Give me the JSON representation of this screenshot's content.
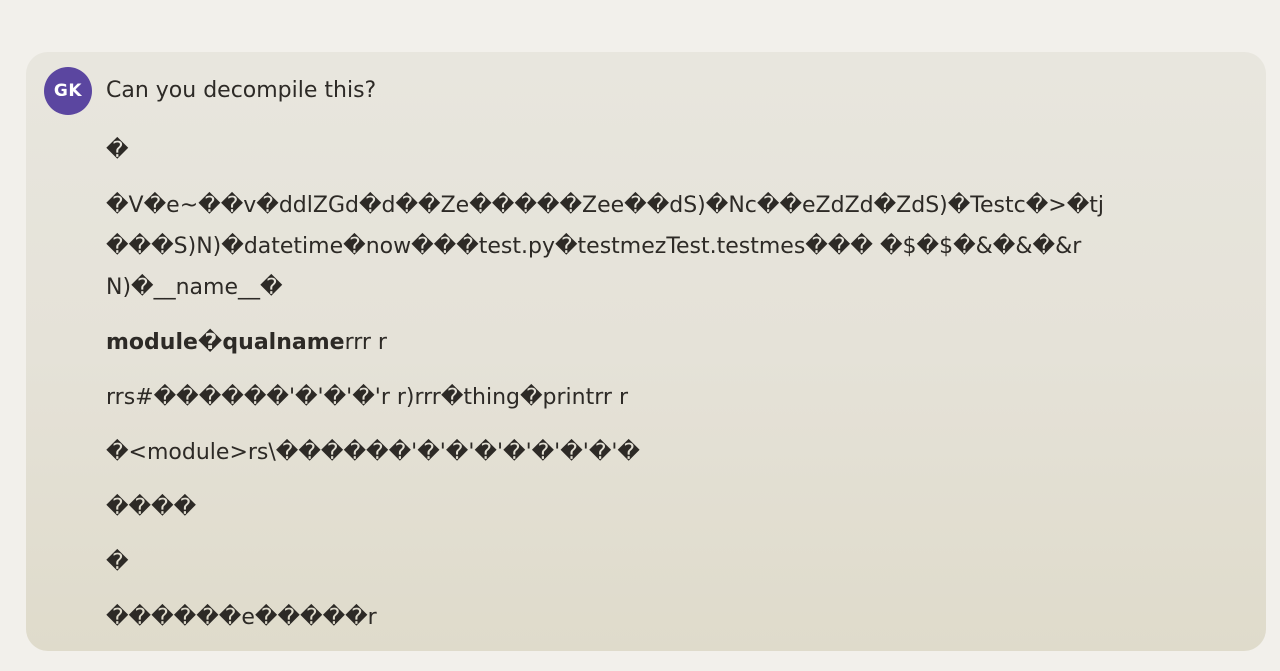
{
  "message": {
    "avatar_initials": "GK",
    "avatar_color": "#5b46a0",
    "prompt": "Can you decompile this?",
    "lines": {
      "l1": "�",
      "l2": "�V�e~��v�ddlZGd�d��Ze�����Zee��dS)�Nc��eZdZd�ZdS)�Testc�>�tj",
      "l3": "���S)N)�datetime�now���test.py�testmezTest.testmes��� �$�$�&�&�&r",
      "l4": "N)�__name__�",
      "l5_bold": "module�qualname",
      "l5_rest": "rrr r",
      "l6": "rrs#������'�'�'�'r r)rrr�thing�printrr r",
      "l7": "�<module>rs\\������'�'�'�'�'�'�'�'�",
      "l8": "����",
      "l9": "�",
      "l10": "������e�����r"
    }
  }
}
